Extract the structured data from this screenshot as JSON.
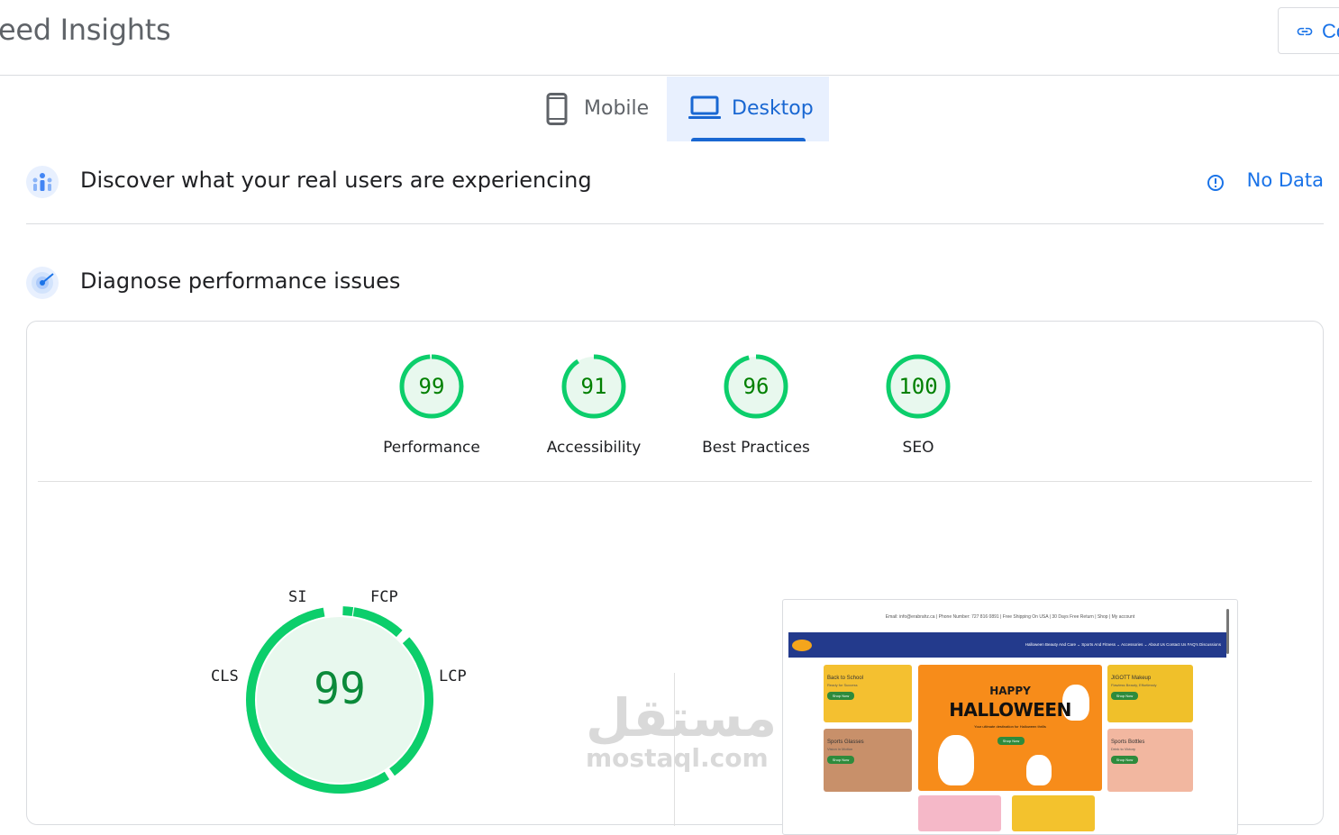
{
  "header": {
    "title": "eed Insights",
    "copy_label": "Co"
  },
  "tabs": [
    {
      "label": "Mobile",
      "selected": false
    },
    {
      "label": "Desktop",
      "selected": true
    }
  ],
  "crux": {
    "title": "Discover what your real users are experiencing",
    "status": "No Data"
  },
  "diagnose": {
    "title": "Diagnose performance issues"
  },
  "scores": [
    {
      "value": "99",
      "label": "Performance",
      "fraction": 0.99
    },
    {
      "value": "91",
      "label": "Accessibility",
      "fraction": 0.91
    },
    {
      "value": "96",
      "label": "Best Practices",
      "fraction": 0.96
    },
    {
      "value": "100",
      "label": "SEO",
      "fraction": 1.0
    }
  ],
  "performance_gauge": {
    "score": "99",
    "metrics": {
      "si": "SI",
      "fcp": "FCP",
      "lcp": "LCP",
      "cls": "CLS"
    }
  },
  "watermark": {
    "arabic": "مستقل",
    "latin": "mostaql.com"
  },
  "screenshot": {
    "topline": "Email: info@erabrahz.ca | Phone Number: 727 816 0891 | Free Shipping On USA | 30 Days Free Return | Shop | My account",
    "nav_links": "Halloween   Beauty And Care ⌄   Sports And Fitness ⌄   Accessories ⌄   About Us   Contact Us   FAQ's   Discussions",
    "tile1_title": "Back to School",
    "tile1_sub": "Ready for Success",
    "tile2_title": "Sports Glasses",
    "tile2_sub": "Vision in Motion",
    "tile3_title": "JIGOTT Makeup",
    "tile3_sub": "Flawless Beauty, Effortlessly",
    "tile4_title": "Sports Bottles",
    "tile4_sub": "Drink to Victory",
    "hero_line1": "HAPPY",
    "hero_line2": "HALLOWEEN",
    "hero_sub": "Your ultimate destination for Halloween thrills",
    "shop_now": "Shop Now"
  },
  "colors": {
    "pass_green": "#0cce6b",
    "pass_fill": "#e8f8ee",
    "score_text": "#008000",
    "accent_blue": "#1a73e8",
    "tab_selected_bg": "#e8f0fe"
  },
  "icons": [
    "link-icon",
    "phone-icon",
    "laptop-icon",
    "crux-users-icon",
    "diagnose-radar-icon",
    "info-icon"
  ]
}
